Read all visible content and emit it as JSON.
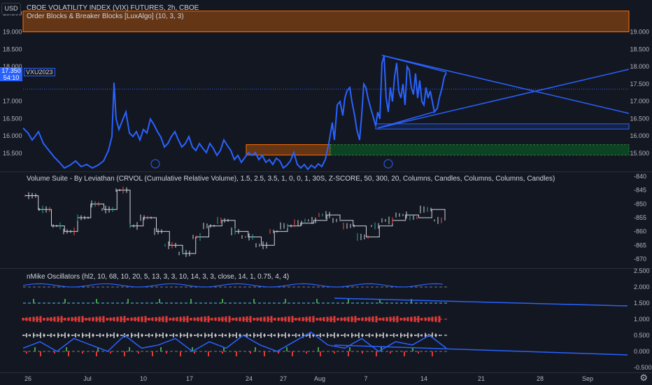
{
  "header": {
    "usd_button": "USD",
    "main_title": "CBOE VOLATILITY INDEX (VIX) FUTURES, 2h, CBOE",
    "indicator_1": "Order Blocks & Breaker Blocks [LuxAlgo] (10, 3, 3)",
    "price_tag_value": "17.350",
    "price_tag_time": "54:10",
    "symbol_tag": "VXU2023"
  },
  "pane2": {
    "title": "Volume Suite - By Leviathan (CRVOL (Cumulative Relative Volume), 1.5, 2.5, 3.5, 1, 0, 0, 1, 30S, Z-SCORE, 50, 300, 20, Columns, Candles, Columns, Columns, Candles)"
  },
  "pane3": {
    "title": "nMike Oscillators (hl2, 10, 68, 10, 20, 5, 13, 3, 3, 10, 14, 3, 3, close, 14, 1, 0.75, 4, 4)"
  },
  "axes": {
    "price_ticks": [
      "19.000",
      "18.500",
      "18.000",
      "17.500",
      "17.000",
      "16.500",
      "16.000",
      "15.500"
    ],
    "price_partial": "19.500",
    "vol_ticks": [
      "-840",
      "-845",
      "-850",
      "-855",
      "-860",
      "-865",
      "-870"
    ],
    "osc_ticks": [
      "2.500",
      "2.000",
      "1.500",
      "1.000",
      "0.500",
      "0.000",
      "-0.500"
    ],
    "x_labels": [
      "26",
      "Jul",
      "10",
      "17",
      "24",
      "27",
      "Aug",
      "7",
      "14",
      "21",
      "28",
      "Sep"
    ]
  },
  "chart_data": [
    {
      "type": "line",
      "title": "CBOE VOLATILITY INDEX (VIX) FUTURES, 2h, CBOE",
      "series": [
        {
          "name": "VXU2023",
          "x": [
            0,
            3,
            5,
            7,
            9,
            12,
            15,
            18,
            20,
            23,
            26,
            28,
            30,
            33,
            36,
            38,
            40,
            43,
            46,
            48,
            50,
            53,
            56,
            58,
            60,
            63,
            66,
            68,
            70,
            73,
            76,
            78,
            80,
            83,
            86,
            88,
            90,
            93,
            96,
            98,
            100
          ],
          "values": [
            16.2,
            15.9,
            15.6,
            15.3,
            15.2,
            15.3,
            15.5,
            15.4,
            17.3,
            16.0,
            16.2,
            16.0,
            15.8,
            15.9,
            15.7,
            15.5,
            15.8,
            15.9,
            15.6,
            15.4,
            15.3,
            15.4,
            15.2,
            15.3,
            15.4,
            15.5,
            15.6,
            16.6,
            17.4,
            16.8,
            17.3,
            16.4,
            18.3,
            17.1,
            17.9,
            17.5,
            16.8,
            17.4,
            17.8,
            17.6,
            17.35
          ]
        }
      ],
      "ylim": [
        15.2,
        19.6
      ],
      "annotations": [
        "order block 19.0-19.6",
        "order block 15.5-15.75",
        "order block 15.5-15.75 (green)",
        "triangle trendlines"
      ]
    },
    {
      "type": "line",
      "title": "Volume Suite - By Leviathan",
      "series": [
        {
          "name": "CRVOL",
          "values": [
            -847,
            -852,
            -858,
            -860,
            -855,
            -850,
            -852,
            -845,
            -858,
            -855,
            -860,
            -865,
            -868,
            -862,
            -858,
            -856,
            -860,
            -862,
            -865,
            -860,
            -858,
            -857,
            -856,
            -854,
            -856,
            -858,
            -862,
            -858,
            -856,
            -854,
            -855,
            -852,
            -856
          ]
        }
      ],
      "ylim": [
        -872,
        -838
      ]
    },
    {
      "type": "line",
      "title": "nMike Oscillators",
      "series": [
        {
          "name": "oscillator",
          "values": [
            0.1,
            0.3,
            0.0,
            0.4,
            0.2,
            0.0,
            0.5,
            0.1,
            0.2,
            0.4,
            0.0,
            0.3,
            0.1,
            0.5,
            0.2,
            0.0,
            0.3,
            0.6,
            0.2,
            0.1,
            0.4,
            0.0,
            0.3,
            0.2,
            0.5,
            0.1
          ]
        }
      ],
      "ylim": [
        -0.6,
        2.5
      ]
    }
  ]
}
